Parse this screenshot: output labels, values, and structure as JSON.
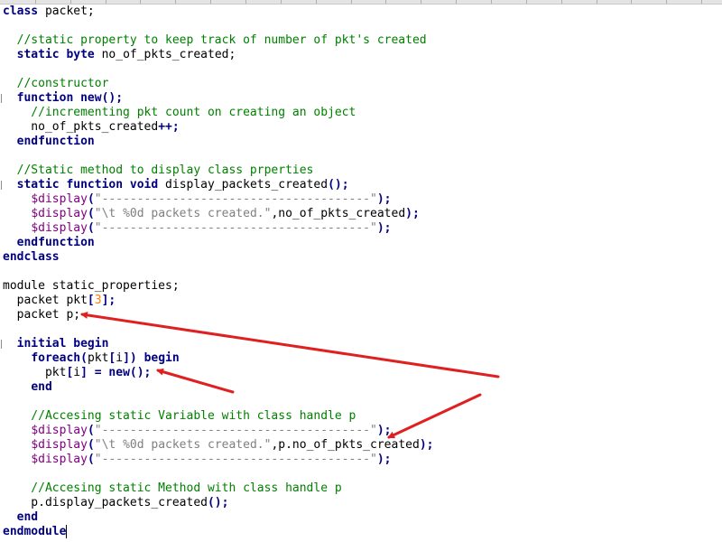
{
  "colors": {
    "keyword": "#000080",
    "comment": "#008000",
    "string": "#808080",
    "system_task": "#800080",
    "number": "#ff8000",
    "plain": "#000000",
    "annotation_arrow": "#e02020",
    "background": "#ffffff"
  },
  "code": {
    "lines": [
      [
        {
          "t": "class",
          "c": "kw"
        },
        {
          "t": " packet;",
          "c": "pl"
        }
      ],
      [],
      [
        {
          "t": "  //static property to keep track of number of pkt's created",
          "c": "cm"
        }
      ],
      [
        {
          "t": "  ",
          "c": "pl"
        },
        {
          "t": "static",
          "c": "kw"
        },
        {
          "t": " ",
          "c": "pl"
        },
        {
          "t": "byte",
          "c": "kw"
        },
        {
          "t": " no_of_pkts_created;",
          "c": "pl"
        }
      ],
      [],
      [
        {
          "t": "  //constructor",
          "c": "cm"
        }
      ],
      [
        {
          "t": "  ",
          "c": "pl"
        },
        {
          "t": "function",
          "c": "kw"
        },
        {
          "t": " ",
          "c": "pl"
        },
        {
          "t": "new",
          "c": "kw"
        },
        {
          "t": "();",
          "c": "op"
        }
      ],
      [
        {
          "t": "    //incrementing pkt count on creating an object",
          "c": "cm"
        }
      ],
      [
        {
          "t": "    no_of_pkts_created",
          "c": "pl"
        },
        {
          "t": "++;",
          "c": "op"
        }
      ],
      [
        {
          "t": "  ",
          "c": "pl"
        },
        {
          "t": "endfunction",
          "c": "kw"
        }
      ],
      [],
      [
        {
          "t": "  //Static method to display class prperties",
          "c": "cm"
        }
      ],
      [
        {
          "t": "  ",
          "c": "pl"
        },
        {
          "t": "static",
          "c": "kw"
        },
        {
          "t": " ",
          "c": "pl"
        },
        {
          "t": "function",
          "c": "kw"
        },
        {
          "t": " ",
          "c": "pl"
        },
        {
          "t": "void",
          "c": "kw"
        },
        {
          "t": " display_packets_created",
          "c": "pl"
        },
        {
          "t": "();",
          "c": "op"
        }
      ],
      [
        {
          "t": "    ",
          "c": "pl"
        },
        {
          "t": "$display",
          "c": "sys"
        },
        {
          "t": "(",
          "c": "op"
        },
        {
          "t": "\"--------------------------------------\"",
          "c": "str"
        },
        {
          "t": ");",
          "c": "op"
        }
      ],
      [
        {
          "t": "    ",
          "c": "pl"
        },
        {
          "t": "$display",
          "c": "sys"
        },
        {
          "t": "(",
          "c": "op"
        },
        {
          "t": "\"\\t %0d packets created.\"",
          "c": "str"
        },
        {
          "t": ",no_of_pkts_created",
          "c": "pl"
        },
        {
          "t": ");",
          "c": "op"
        }
      ],
      [
        {
          "t": "    ",
          "c": "pl"
        },
        {
          "t": "$display",
          "c": "sys"
        },
        {
          "t": "(",
          "c": "op"
        },
        {
          "t": "\"--------------------------------------\"",
          "c": "str"
        },
        {
          "t": ");",
          "c": "op"
        }
      ],
      [
        {
          "t": "  ",
          "c": "pl"
        },
        {
          "t": "endfunction",
          "c": "kw"
        }
      ],
      [
        {
          "t": "endclass",
          "c": "kw"
        }
      ],
      [],
      [
        {
          "t": "module static_properties;",
          "c": "pl"
        }
      ],
      [
        {
          "t": "  packet pkt",
          "c": "pl"
        },
        {
          "t": "[",
          "c": "op"
        },
        {
          "t": "3",
          "c": "num"
        },
        {
          "t": "];",
          "c": "op"
        }
      ],
      [
        {
          "t": "  packet p;",
          "c": "pl"
        }
      ],
      [],
      [
        {
          "t": "  ",
          "c": "pl"
        },
        {
          "t": "initial",
          "c": "kw"
        },
        {
          "t": " ",
          "c": "pl"
        },
        {
          "t": "begin",
          "c": "kw"
        }
      ],
      [
        {
          "t": "    ",
          "c": "pl"
        },
        {
          "t": "foreach",
          "c": "kw"
        },
        {
          "t": "(",
          "c": "op"
        },
        {
          "t": "pkt",
          "c": "pl"
        },
        {
          "t": "[",
          "c": "op"
        },
        {
          "t": "i",
          "c": "pl"
        },
        {
          "t": "])",
          "c": "op"
        },
        {
          "t": " ",
          "c": "pl"
        },
        {
          "t": "begin",
          "c": "kw"
        }
      ],
      [
        {
          "t": "      pkt",
          "c": "pl"
        },
        {
          "t": "[",
          "c": "op"
        },
        {
          "t": "i",
          "c": "pl"
        },
        {
          "t": "]",
          "c": "op"
        },
        {
          "t": " ",
          "c": "pl"
        },
        {
          "t": "=",
          "c": "op"
        },
        {
          "t": " ",
          "c": "pl"
        },
        {
          "t": "new",
          "c": "kw"
        },
        {
          "t": "();",
          "c": "op"
        }
      ],
      [
        {
          "t": "    ",
          "c": "pl"
        },
        {
          "t": "end",
          "c": "kw"
        }
      ],
      [],
      [
        {
          "t": "    //Accesing static Variable with class handle p",
          "c": "cm"
        }
      ],
      [
        {
          "t": "    ",
          "c": "pl"
        },
        {
          "t": "$display",
          "c": "sys"
        },
        {
          "t": "(",
          "c": "op"
        },
        {
          "t": "\"--------------------------------------\"",
          "c": "str"
        },
        {
          "t": ");",
          "c": "op"
        }
      ],
      [
        {
          "t": "    ",
          "c": "pl"
        },
        {
          "t": "$display",
          "c": "sys"
        },
        {
          "t": "(",
          "c": "op"
        },
        {
          "t": "\"\\t %0d packets created.\"",
          "c": "str"
        },
        {
          "t": ",p.no_of_pkts_created",
          "c": "pl"
        },
        {
          "t": ");",
          "c": "op"
        }
      ],
      [
        {
          "t": "    ",
          "c": "pl"
        },
        {
          "t": "$display",
          "c": "sys"
        },
        {
          "t": "(",
          "c": "op"
        },
        {
          "t": "\"--------------------------------------\"",
          "c": "str"
        },
        {
          "t": ");",
          "c": "op"
        }
      ],
      [],
      [
        {
          "t": "    //Accesing static Method with class handle p",
          "c": "cm"
        }
      ],
      [
        {
          "t": "    p.display_packets_created",
          "c": "pl"
        },
        {
          "t": "();",
          "c": "op"
        }
      ],
      [
        {
          "t": "  ",
          "c": "pl"
        },
        {
          "t": "end",
          "c": "kw"
        }
      ],
      [
        {
          "t": "endmodule",
          "c": "kw"
        }
      ]
    ]
  }
}
